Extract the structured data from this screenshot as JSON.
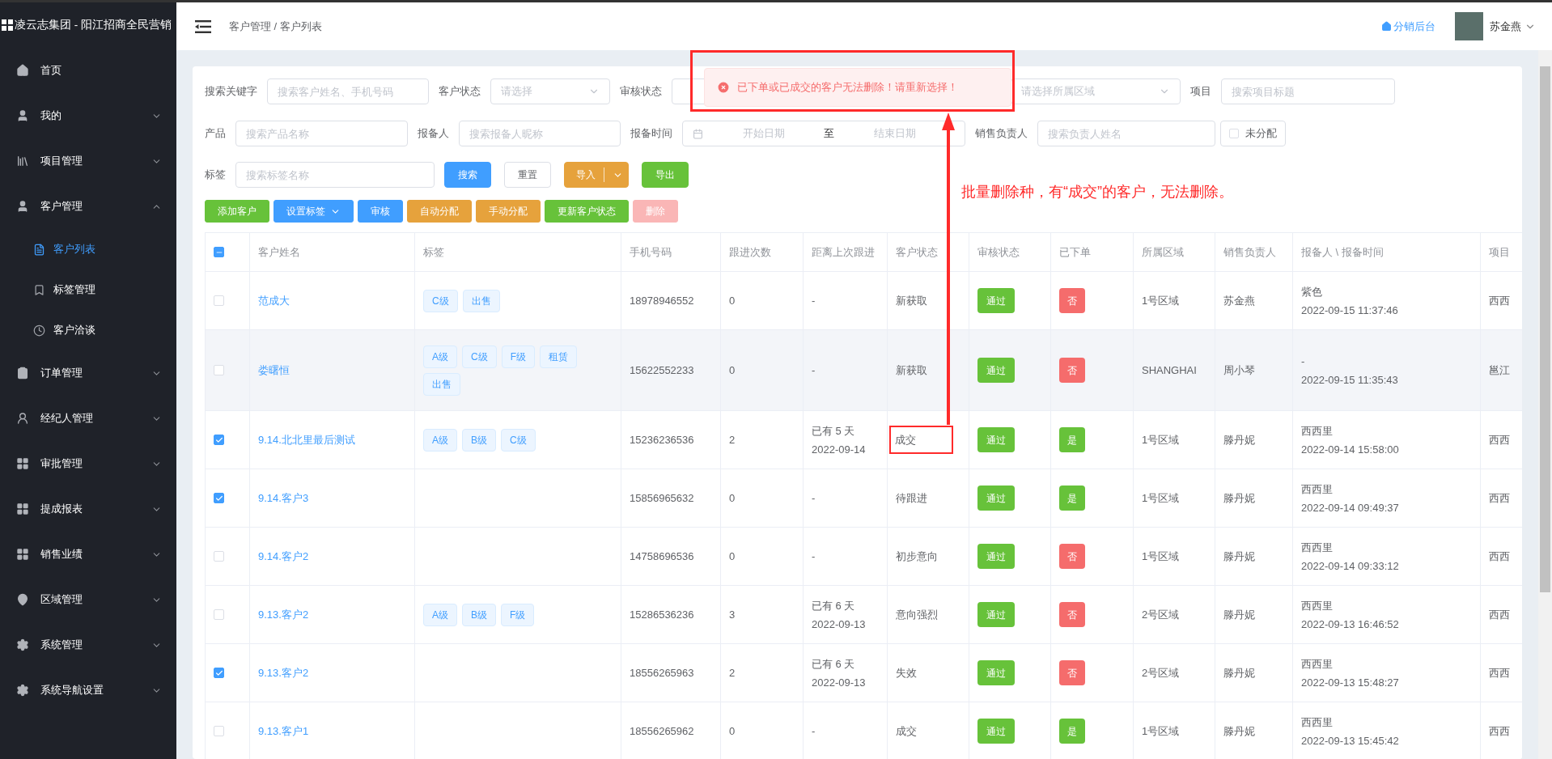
{
  "sidebar": {
    "title": "凌云志集团 - 阳江招商全民营销",
    "items": [
      {
        "label": "首页",
        "has_children": false
      },
      {
        "label": "我的",
        "expanded": false,
        "has_children": true
      },
      {
        "label": "项目管理",
        "expanded": false,
        "has_children": true
      },
      {
        "label": "客户管理",
        "expanded": true,
        "has_children": true,
        "children": [
          {
            "label": "客户列表",
            "selected": true
          },
          {
            "label": "标签管理",
            "selected": false
          },
          {
            "label": "客户洽谈",
            "selected": false
          }
        ]
      },
      {
        "label": "订单管理",
        "expanded": false,
        "has_children": true
      },
      {
        "label": "经纪人管理",
        "expanded": false,
        "has_children": true
      },
      {
        "label": "审批管理",
        "expanded": false,
        "has_children": true
      },
      {
        "label": "提成报表",
        "expanded": false,
        "has_children": true
      },
      {
        "label": "销售业绩",
        "expanded": false,
        "has_children": true
      },
      {
        "label": "区域管理",
        "expanded": false,
        "has_children": true
      },
      {
        "label": "系统管理",
        "expanded": false,
        "has_children": true
      },
      {
        "label": "系统导航设置",
        "expanded": false,
        "has_children": true
      }
    ]
  },
  "header": {
    "breadcrumb": "客户管理 / 客户列表",
    "backend_link": "分销后台",
    "user": "苏金燕"
  },
  "filters": {
    "keyword": {
      "label": "搜索关键字",
      "placeholder": "搜索客户姓名、手机号码"
    },
    "customer_status": {
      "label": "客户状态",
      "placeholder": "请选择"
    },
    "audit_status": {
      "label": "审核状态"
    },
    "region": {
      "placeholder": "请选择所属区域"
    },
    "project": {
      "label": "项目",
      "placeholder": "搜索项目标题"
    },
    "product": {
      "label": "产品",
      "placeholder": "搜索产品名称"
    },
    "reporter": {
      "label": "报备人",
      "placeholder": "搜索报备人昵称"
    },
    "report_time": {
      "label": "报备时间",
      "start_placeholder": "开始日期",
      "separator": "至",
      "end_placeholder": "结束日期"
    },
    "sales_owner": {
      "label": "销售负责人",
      "placeholder": "搜索负责人姓名"
    },
    "unassigned": {
      "label": "未分配",
      "checked": false
    },
    "tag": {
      "label": "标签",
      "placeholder": "搜索标签名称"
    },
    "buttons": [
      {
        "label": "搜索",
        "kind": "primary"
      },
      {
        "label": "重置",
        "kind": "plain"
      },
      {
        "label": "导入",
        "kind": "split"
      },
      {
        "label": "导出",
        "kind": "success"
      }
    ]
  },
  "actions": [
    {
      "label": "添加客户",
      "kind": "success"
    },
    {
      "label": "设置标签",
      "kind": "dropdown"
    },
    {
      "label": "审核",
      "kind": "primary"
    },
    {
      "label": "自动分配",
      "kind": "warning"
    },
    {
      "label": "手动分配",
      "kind": "warning"
    },
    {
      "label": "更新客户状态",
      "kind": "success"
    },
    {
      "label": "删除",
      "kind": "danger_disabled"
    }
  ],
  "table": {
    "select_all": {
      "indeterminate": true
    },
    "columns": [
      "客户姓名",
      "标签",
      "手机号码",
      "跟进次数",
      "距离上次跟进",
      "客户状态",
      "审核状态",
      "已下单",
      "所属区域",
      "销售负责人",
      "报备人 \\ 报备时间",
      "项目"
    ],
    "rows": [
      {
        "checked": false,
        "highlighted": false,
        "name": "范成大",
        "tags": [
          "C级",
          "出售"
        ],
        "phone": "18978946552",
        "follow_count": "0",
        "since_last": [
          "-"
        ],
        "status": "新获取",
        "status_marked": false,
        "audit": "通过",
        "ordered": {
          "label": "否",
          "kind": "no"
        },
        "region": "1号区域",
        "sales": "苏金燕",
        "reporter": "紫色",
        "report_time": "2022-09-15 11:37:46",
        "project": "西西"
      },
      {
        "checked": false,
        "highlighted": true,
        "name": "娄曙恒",
        "tags": [
          "A级",
          "C级",
          "F级",
          "租赁",
          "出售"
        ],
        "phone": "15622552233",
        "follow_count": "0",
        "since_last": [
          "-"
        ],
        "status": "新获取",
        "status_marked": false,
        "audit": "通过",
        "ordered": {
          "label": "否",
          "kind": "no"
        },
        "region": "SHANGHAI",
        "sales": "周小琴",
        "reporter": "-",
        "report_time": "2022-09-15 11:35:43",
        "project": "邕江"
      },
      {
        "checked": true,
        "highlighted": false,
        "name": "9.14.北北里最后测试",
        "tags": [
          "A级",
          "B级",
          "C级"
        ],
        "phone": "15236236536",
        "follow_count": "2",
        "since_last": [
          "已有 5 天",
          "2022-09-14"
        ],
        "status": "成交",
        "status_marked": true,
        "audit": "通过",
        "ordered": {
          "label": "是",
          "kind": "yes"
        },
        "region": "1号区域",
        "sales": "滕丹妮",
        "reporter": "西西里",
        "report_time": "2022-09-14 15:58:00",
        "project": "西西"
      },
      {
        "checked": true,
        "highlighted": false,
        "name": "9.14.客户3",
        "tags": [],
        "phone": "15856965632",
        "follow_count": "0",
        "since_last": [
          "-"
        ],
        "status": "待跟进",
        "status_marked": false,
        "audit": "通过",
        "ordered": {
          "label": "是",
          "kind": "yes"
        },
        "region": "1号区域",
        "sales": "滕丹妮",
        "reporter": "西西里",
        "report_time": "2022-09-14 09:49:37",
        "project": "西西"
      },
      {
        "checked": false,
        "highlighted": false,
        "name": "9.14.客户2",
        "tags": [],
        "phone": "14758696536",
        "follow_count": "0",
        "since_last": [
          "-"
        ],
        "status": "初步意向",
        "status_marked": false,
        "audit": "通过",
        "ordered": {
          "label": "否",
          "kind": "no"
        },
        "region": "1号区域",
        "sales": "滕丹妮",
        "reporter": "西西里",
        "report_time": "2022-09-14 09:33:12",
        "project": "西西"
      },
      {
        "checked": false,
        "highlighted": false,
        "name": "9.13.客户2",
        "tags": [
          "A级",
          "B级",
          "F级"
        ],
        "phone": "15286536236",
        "follow_count": "3",
        "since_last": [
          "已有 6 天",
          "2022-09-13"
        ],
        "status": "意向强烈",
        "status_marked": false,
        "audit": "通过",
        "ordered": {
          "label": "否",
          "kind": "no"
        },
        "region": "2号区域",
        "sales": "滕丹妮",
        "reporter": "西西里",
        "report_time": "2022-09-13 16:46:52",
        "project": "西西"
      },
      {
        "checked": true,
        "highlighted": false,
        "name": "9.13.客户2",
        "tags": [],
        "phone": "18556265963",
        "follow_count": "2",
        "since_last": [
          "已有 6 天",
          "2022-09-13"
        ],
        "status": "失效",
        "status_marked": false,
        "audit": "通过",
        "ordered": {
          "label": "否",
          "kind": "no"
        },
        "region": "2号区域",
        "sales": "滕丹妮",
        "reporter": "西西里",
        "report_time": "2022-09-13 15:48:27",
        "project": "西西"
      },
      {
        "checked": false,
        "highlighted": false,
        "name": "9.13.客户1",
        "tags": [],
        "phone": "18556265962",
        "follow_count": "0",
        "since_last": [
          "-"
        ],
        "status": "成交",
        "status_marked": false,
        "audit": "通过",
        "ordered": {
          "label": "是",
          "kind": "yes"
        },
        "region": "1号区域",
        "sales": "滕丹妮",
        "reporter": "西西里",
        "report_time": "2022-09-13 15:45:42",
        "project": "西西"
      }
    ]
  },
  "toast": {
    "kind": "error",
    "message": "已下单或已成交的客户无法删除！请重新选择！"
  },
  "annotation": {
    "text": "批量删除种，有“成交”的客户，无法删除。"
  }
}
